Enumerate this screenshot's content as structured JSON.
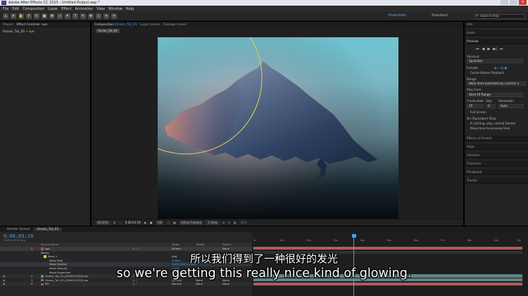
{
  "window": {
    "title": "Adobe After Effects CC 2015 - Untitled Project.aep *",
    "app_icon": "Ae"
  },
  "menu": [
    "File",
    "Edit",
    "Composition",
    "Layer",
    "Effect",
    "Animation",
    "View",
    "Window",
    "Help"
  ],
  "workspaces": {
    "active": "Essentials",
    "other": "Standard",
    "search_placeholder": "Search Help"
  },
  "left_panel": {
    "tabs": [
      "Project",
      "Effect Controls: sun"
    ],
    "item": "Ocean_Tut_01 • sun"
  },
  "composition_panel": {
    "tabs": {
      "composition": "Composition",
      "comp_name": "Ocean_Tut_01",
      "layer": "Layer (none)",
      "footage": "Footage (none)"
    },
    "sub_tab": "Ocean_Tut_01",
    "footer": {
      "zoom": "(60.0%)",
      "timecode": "0:00:03:19",
      "resolution": "Full",
      "camera": "Active Camera",
      "views": "1 View",
      "exposure": "+0.0"
    }
  },
  "right_panel": {
    "sections": [
      "Info",
      "Audio",
      "Preview"
    ],
    "preview": {
      "shortcut_label": "Shortcut",
      "shortcut_value": "Spacebar",
      "include_label": "Include:",
      "cache_label": "Cache Before Playback",
      "range_label": "Range",
      "range_value": "Work Area Extended By Current Ti",
      "play_from_label": "Play From",
      "play_from_value": "Start Of Range",
      "frame_rate_label": "Frame Rate",
      "skip_label": "Skip",
      "resolution_label": "Resolution",
      "frame_rate_value": "25",
      "skip_value": "0",
      "resolution_value": "Auto",
      "full_screen_label": "Full Screen",
      "on_stop_label": "On (Spacebar) Stop:",
      "if_caching_label": "If caching, play cached frames",
      "move_time_label": "Move time to preview time"
    },
    "lower_sections": [
      "Effects & Presets",
      "Align",
      "Libraries",
      "Character",
      "Paragraph",
      "Tracker"
    ]
  },
  "timeline": {
    "tabs": [
      "Render Queue",
      "Ocean_Tut_01"
    ],
    "timecode": "0;00;03;19",
    "fps": "00094 (25.00 fps)",
    "headers": {
      "source_name": "Source Name",
      "mode": "Mode",
      "trkmat": "TrkMat",
      "parent": "Parent"
    },
    "rows": [
      {
        "num": "1",
        "name": "sun",
        "mode": "Screen",
        "trk": "",
        "parent": "None"
      },
      {
        "num": "",
        "name": "Masks",
        "mode": "",
        "trk": "",
        "parent": ""
      },
      {
        "num": "",
        "name": "Mask 1",
        "mode": "Add",
        "trk": "Inverted",
        "parent": ""
      },
      {
        "num": "",
        "name": "Mask Path",
        "mode": "Shape...",
        "trk": "",
        "parent": ""
      },
      {
        "num": "",
        "name": "Mask Feather",
        "mode": "100.0,100.0 pixels",
        "trk": "",
        "parent": ""
      },
      {
        "num": "",
        "name": "Mask Opacity",
        "mode": "100%",
        "trk": "",
        "parent": ""
      },
      {
        "num": "",
        "name": "Mask Expansion",
        "mode": "0.0 pixels",
        "trk": "",
        "parent": ""
      },
      {
        "num": "2",
        "name": "Ocean_Tut_01_[00000-0250].exr",
        "mode": "Normal",
        "trk": "None",
        "parent": "None"
      },
      {
        "num": "3",
        "name": "Ocean_Tut_01_[00000-0250].exr",
        "mode": "Normal",
        "trk": "None",
        "parent": "None"
      },
      {
        "num": "4",
        "name": "BG",
        "mode": "Normal",
        "trk": "None",
        "parent": "None"
      }
    ],
    "ruler_labels": [
      "0s",
      "01s",
      "02s",
      "03s",
      "04s",
      "05s",
      "06s",
      "07s",
      "08s",
      "09s",
      "10s"
    ],
    "colors": {
      "timecode": "#3fa3ff",
      "sun_bar": "#b45a5e",
      "layer_bar": "#5e8586",
      "bg_bar": "#b45a5e"
    }
  },
  "subtitles": {
    "chinese": "所以我们得到了一种很好的发光",
    "english": "so we're getting this really nice kind of glowing."
  }
}
